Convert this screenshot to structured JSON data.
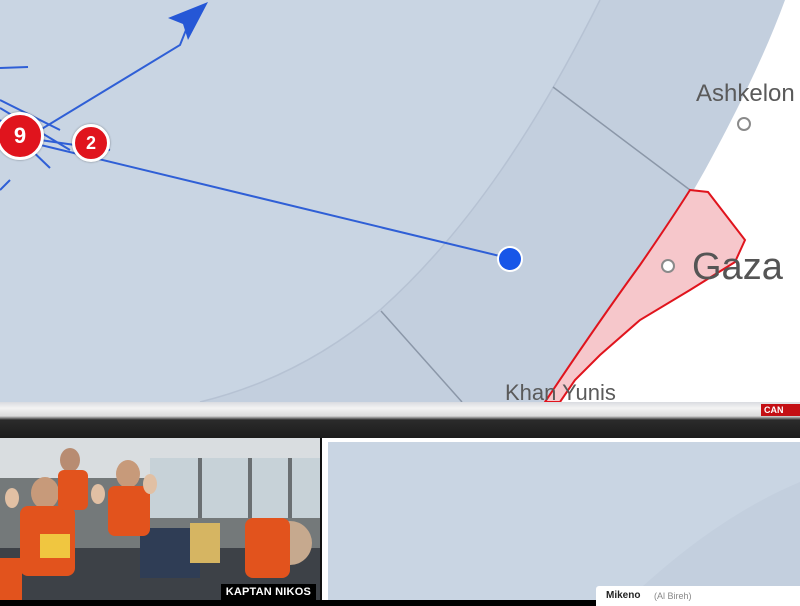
{
  "map": {
    "labels": {
      "ashkelon": "Ashkelon",
      "gaza": "Gaza",
      "khan_yunis": "Khan Yunis"
    },
    "markers": [
      {
        "id": "cluster-9",
        "count": "9"
      },
      {
        "id": "cluster-2",
        "count": "2"
      }
    ],
    "colors": {
      "sea": "#c9d5e3",
      "land": "#ffffff",
      "route": "#2f5fd6",
      "gaza_fill": "#f6c7cb",
      "gaza_border": "#e0141d",
      "marker": "#e0141d"
    }
  },
  "broadcast": {
    "channel_tag": "CAN",
    "video_caption": "KAPTAN NIKOS"
  },
  "info_card": {
    "name": "Mikeno",
    "sub": "(Al Bireh)"
  }
}
